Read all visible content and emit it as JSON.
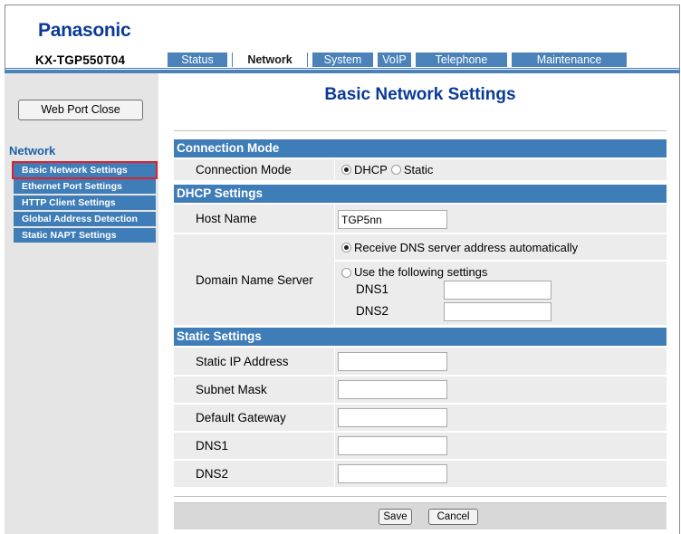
{
  "brand": "Panasonic",
  "model": "KX-TGP550T04",
  "tabs": [
    {
      "label": "Status"
    },
    {
      "label": "Network"
    },
    {
      "label": "System"
    },
    {
      "label": "VoIP"
    },
    {
      "label": "Telephone"
    },
    {
      "label": "Maintenance"
    }
  ],
  "active_tab": "Network",
  "sidebar": {
    "web_port_button": "Web Port Close",
    "heading": "Network",
    "items": [
      {
        "label": "Basic Network Settings"
      },
      {
        "label": "Ethernet Port Settings"
      },
      {
        "label": "HTTP Client Settings"
      },
      {
        "label": "Global Address Detection"
      },
      {
        "label": "Static NAPT Settings"
      }
    ]
  },
  "page_title": "Basic Network Settings",
  "connection": {
    "section": "Connection Mode",
    "label": "Connection Mode",
    "options": [
      "DHCP",
      "Static"
    ],
    "selected": "DHCP"
  },
  "dhcp": {
    "section": "DHCP Settings",
    "host_label": "Host Name",
    "host_value": "TGP5nn",
    "dns_label": "Domain Name Server",
    "dns_auto": "Receive DNS server address automatically",
    "dns_manual": "Use the following settings",
    "dns1_label": "DNS1",
    "dns2_label": "DNS2",
    "dns1_value": "",
    "dns2_value": ""
  },
  "static": {
    "section": "Static Settings",
    "ip_label": "Static IP Address",
    "mask_label": "Subnet Mask",
    "gateway_label": "Default Gateway",
    "dns1_label": "DNS1",
    "dns2_label": "DNS2",
    "ip_value": "",
    "mask_value": "",
    "gateway_value": "",
    "dns1_value": "",
    "dns2_value": ""
  },
  "footer": {
    "save": "Save",
    "cancel": "Cancel"
  },
  "colors": {
    "brand_blue": "#0b3a96",
    "tab_blue": "#4a82b9",
    "section_blue": "#3f7db8",
    "selected_outline": "#e0202a"
  }
}
